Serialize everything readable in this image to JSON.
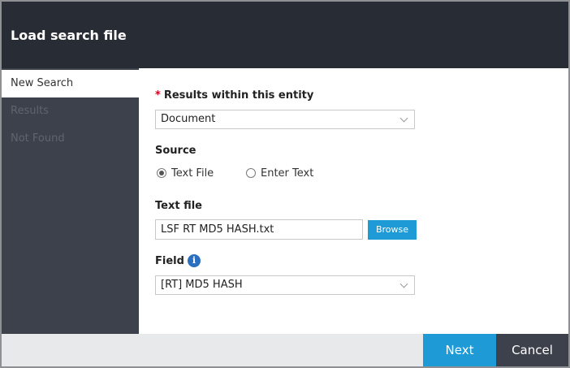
{
  "dialog": {
    "title": "Load search file"
  },
  "sidebar": {
    "items": [
      {
        "label": "New Search",
        "active": true
      },
      {
        "label": "Results",
        "active": false
      },
      {
        "label": "Not Found",
        "active": false
      }
    ]
  },
  "form": {
    "results_entity": {
      "required_mark": "*",
      "label": "Results within this entity",
      "value": "Document"
    },
    "source": {
      "label": "Source",
      "options": [
        {
          "label": "Text File",
          "selected": true
        },
        {
          "label": "Enter Text",
          "selected": false
        }
      ]
    },
    "text_file": {
      "label": "Text file",
      "value": "LSF RT MD5 HASH.txt",
      "browse_label": "Browse"
    },
    "field": {
      "label": "Field",
      "info_icon": "i",
      "value": "[RT] MD5 HASH"
    }
  },
  "footer": {
    "next_label": "Next",
    "cancel_label": "Cancel"
  },
  "colors": {
    "titlebar": "#282d35",
    "sidebar": "#3d414b",
    "accent": "#1e9ad6",
    "required": "#d0021b",
    "info": "#2a6fc0"
  }
}
